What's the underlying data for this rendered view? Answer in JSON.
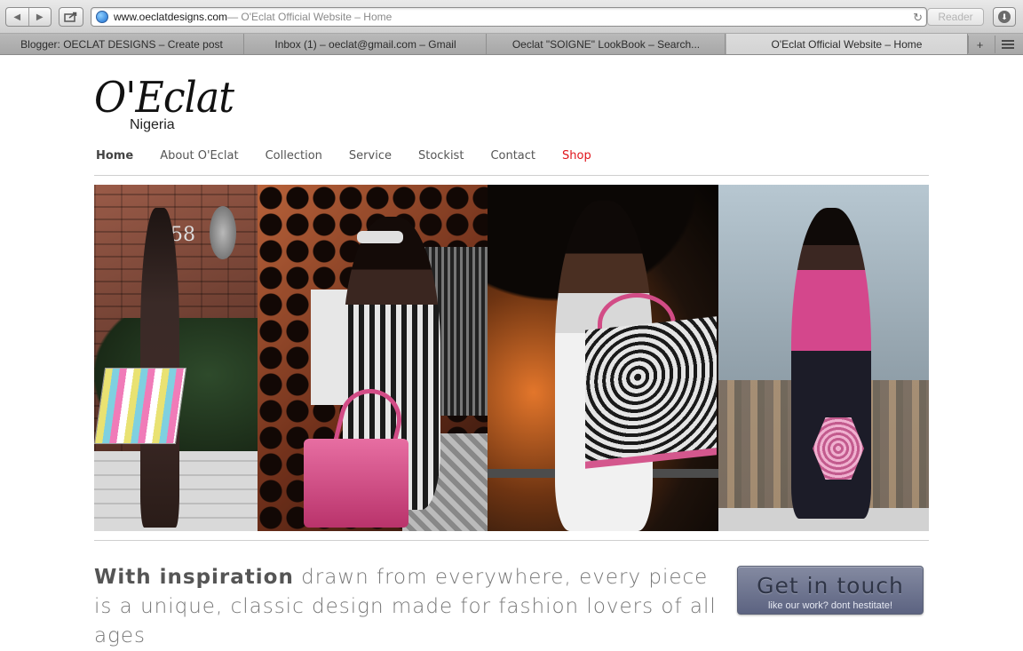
{
  "browser": {
    "url_host": "www.oeclatdesigns.com",
    "url_title": " — O'Eclat Official Website – Home",
    "reader_label": "Reader",
    "tabs": [
      {
        "label": "Blogger: OECLAT DESIGNS – Create post"
      },
      {
        "label": "Inbox (1) – oeclat@gmail.com – Gmail"
      },
      {
        "label": "Oeclat \"SOIGNE\" LookBook – Search..."
      },
      {
        "label": "O'Eclat Official Website – Home"
      }
    ],
    "new_tab_label": "+"
  },
  "site": {
    "logo_main": "O'Eclat",
    "logo_sub": "Nigeria",
    "nav": [
      {
        "label": "Home"
      },
      {
        "label": "About O'Eclat"
      },
      {
        "label": "Collection"
      },
      {
        "label": "Service"
      },
      {
        "label": "Stockist"
      },
      {
        "label": "Contact"
      },
      {
        "label": "Shop"
      }
    ],
    "hero_number": "158",
    "tagline_bold": "With inspiration",
    "tagline_rest": " drawn from everywhere, every piece is a unique, classic design made for fashion lovers of all ages",
    "cta_title": "Get in touch",
    "cta_sub": "like our work? dont hestitate!"
  },
  "colors": {
    "shop_link": "#e0141b",
    "cta_bg": "#6e7593"
  }
}
